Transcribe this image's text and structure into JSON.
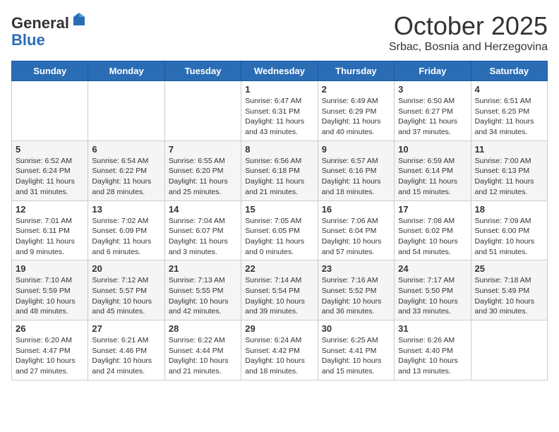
{
  "logo": {
    "general": "General",
    "blue": "Blue"
  },
  "header": {
    "month": "October 2025",
    "location": "Srbac, Bosnia and Herzegovina"
  },
  "weekdays": [
    "Sunday",
    "Monday",
    "Tuesday",
    "Wednesday",
    "Thursday",
    "Friday",
    "Saturday"
  ],
  "weeks": [
    [
      {
        "day": "",
        "sunrise": "",
        "sunset": "",
        "daylight": ""
      },
      {
        "day": "",
        "sunrise": "",
        "sunset": "",
        "daylight": ""
      },
      {
        "day": "",
        "sunrise": "",
        "sunset": "",
        "daylight": ""
      },
      {
        "day": "1",
        "sunrise": "Sunrise: 6:47 AM",
        "sunset": "Sunset: 6:31 PM",
        "daylight": "Daylight: 11 hours and 43 minutes."
      },
      {
        "day": "2",
        "sunrise": "Sunrise: 6:49 AM",
        "sunset": "Sunset: 6:29 PM",
        "daylight": "Daylight: 11 hours and 40 minutes."
      },
      {
        "day": "3",
        "sunrise": "Sunrise: 6:50 AM",
        "sunset": "Sunset: 6:27 PM",
        "daylight": "Daylight: 11 hours and 37 minutes."
      },
      {
        "day": "4",
        "sunrise": "Sunrise: 6:51 AM",
        "sunset": "Sunset: 6:25 PM",
        "daylight": "Daylight: 11 hours and 34 minutes."
      }
    ],
    [
      {
        "day": "5",
        "sunrise": "Sunrise: 6:52 AM",
        "sunset": "Sunset: 6:24 PM",
        "daylight": "Daylight: 11 hours and 31 minutes."
      },
      {
        "day": "6",
        "sunrise": "Sunrise: 6:54 AM",
        "sunset": "Sunset: 6:22 PM",
        "daylight": "Daylight: 11 hours and 28 minutes."
      },
      {
        "day": "7",
        "sunrise": "Sunrise: 6:55 AM",
        "sunset": "Sunset: 6:20 PM",
        "daylight": "Daylight: 11 hours and 25 minutes."
      },
      {
        "day": "8",
        "sunrise": "Sunrise: 6:56 AM",
        "sunset": "Sunset: 6:18 PM",
        "daylight": "Daylight: 11 hours and 21 minutes."
      },
      {
        "day": "9",
        "sunrise": "Sunrise: 6:57 AM",
        "sunset": "Sunset: 6:16 PM",
        "daylight": "Daylight: 11 hours and 18 minutes."
      },
      {
        "day": "10",
        "sunrise": "Sunrise: 6:59 AM",
        "sunset": "Sunset: 6:14 PM",
        "daylight": "Daylight: 11 hours and 15 minutes."
      },
      {
        "day": "11",
        "sunrise": "Sunrise: 7:00 AM",
        "sunset": "Sunset: 6:13 PM",
        "daylight": "Daylight: 11 hours and 12 minutes."
      }
    ],
    [
      {
        "day": "12",
        "sunrise": "Sunrise: 7:01 AM",
        "sunset": "Sunset: 6:11 PM",
        "daylight": "Daylight: 11 hours and 9 minutes."
      },
      {
        "day": "13",
        "sunrise": "Sunrise: 7:02 AM",
        "sunset": "Sunset: 6:09 PM",
        "daylight": "Daylight: 11 hours and 6 minutes."
      },
      {
        "day": "14",
        "sunrise": "Sunrise: 7:04 AM",
        "sunset": "Sunset: 6:07 PM",
        "daylight": "Daylight: 11 hours and 3 minutes."
      },
      {
        "day": "15",
        "sunrise": "Sunrise: 7:05 AM",
        "sunset": "Sunset: 6:05 PM",
        "daylight": "Daylight: 11 hours and 0 minutes."
      },
      {
        "day": "16",
        "sunrise": "Sunrise: 7:06 AM",
        "sunset": "Sunset: 6:04 PM",
        "daylight": "Daylight: 10 hours and 57 minutes."
      },
      {
        "day": "17",
        "sunrise": "Sunrise: 7:08 AM",
        "sunset": "Sunset: 6:02 PM",
        "daylight": "Daylight: 10 hours and 54 minutes."
      },
      {
        "day": "18",
        "sunrise": "Sunrise: 7:09 AM",
        "sunset": "Sunset: 6:00 PM",
        "daylight": "Daylight: 10 hours and 51 minutes."
      }
    ],
    [
      {
        "day": "19",
        "sunrise": "Sunrise: 7:10 AM",
        "sunset": "Sunset: 5:59 PM",
        "daylight": "Daylight: 10 hours and 48 minutes."
      },
      {
        "day": "20",
        "sunrise": "Sunrise: 7:12 AM",
        "sunset": "Sunset: 5:57 PM",
        "daylight": "Daylight: 10 hours and 45 minutes."
      },
      {
        "day": "21",
        "sunrise": "Sunrise: 7:13 AM",
        "sunset": "Sunset: 5:55 PM",
        "daylight": "Daylight: 10 hours and 42 minutes."
      },
      {
        "day": "22",
        "sunrise": "Sunrise: 7:14 AM",
        "sunset": "Sunset: 5:54 PM",
        "daylight": "Daylight: 10 hours and 39 minutes."
      },
      {
        "day": "23",
        "sunrise": "Sunrise: 7:16 AM",
        "sunset": "Sunset: 5:52 PM",
        "daylight": "Daylight: 10 hours and 36 minutes."
      },
      {
        "day": "24",
        "sunrise": "Sunrise: 7:17 AM",
        "sunset": "Sunset: 5:50 PM",
        "daylight": "Daylight: 10 hours and 33 minutes."
      },
      {
        "day": "25",
        "sunrise": "Sunrise: 7:18 AM",
        "sunset": "Sunset: 5:49 PM",
        "daylight": "Daylight: 10 hours and 30 minutes."
      }
    ],
    [
      {
        "day": "26",
        "sunrise": "Sunrise: 6:20 AM",
        "sunset": "Sunset: 4:47 PM",
        "daylight": "Daylight: 10 hours and 27 minutes."
      },
      {
        "day": "27",
        "sunrise": "Sunrise: 6:21 AM",
        "sunset": "Sunset: 4:46 PM",
        "daylight": "Daylight: 10 hours and 24 minutes."
      },
      {
        "day": "28",
        "sunrise": "Sunrise: 6:22 AM",
        "sunset": "Sunset: 4:44 PM",
        "daylight": "Daylight: 10 hours and 21 minutes."
      },
      {
        "day": "29",
        "sunrise": "Sunrise: 6:24 AM",
        "sunset": "Sunset: 4:42 PM",
        "daylight": "Daylight: 10 hours and 18 minutes."
      },
      {
        "day": "30",
        "sunrise": "Sunrise: 6:25 AM",
        "sunset": "Sunset: 4:41 PM",
        "daylight": "Daylight: 10 hours and 15 minutes."
      },
      {
        "day": "31",
        "sunrise": "Sunrise: 6:26 AM",
        "sunset": "Sunset: 4:40 PM",
        "daylight": "Daylight: 10 hours and 13 minutes."
      },
      {
        "day": "",
        "sunrise": "",
        "sunset": "",
        "daylight": ""
      }
    ]
  ]
}
